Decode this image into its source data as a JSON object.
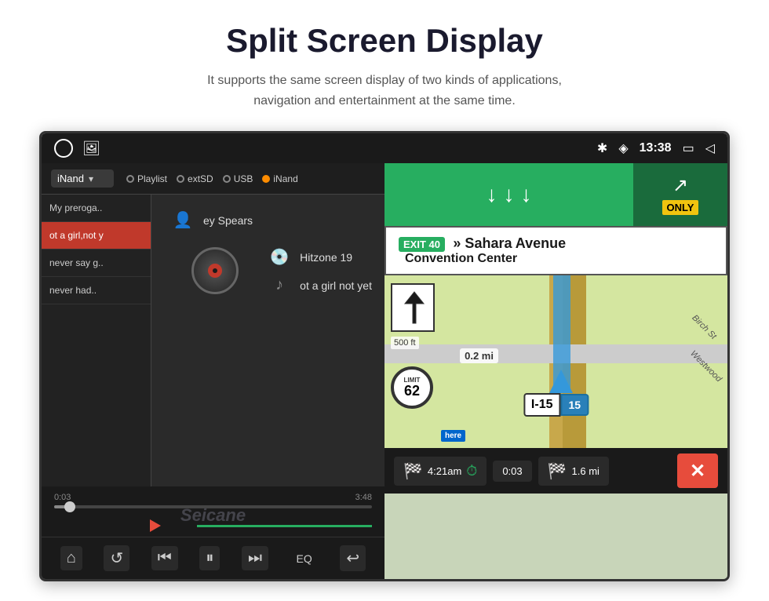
{
  "header": {
    "title": "Split Screen Display",
    "subtitle_line1": "It supports the same screen display of two kinds of applications,",
    "subtitle_line2": "navigation and entertainment at the same time."
  },
  "status_bar": {
    "time": "13:38",
    "icons": [
      "bluetooth",
      "location",
      "screen-record",
      "back"
    ]
  },
  "music_player": {
    "source_dropdown": "iNand",
    "dropdown_arrow": "▾",
    "source_tabs": [
      {
        "label": "Playlist",
        "active": false
      },
      {
        "label": "extSD",
        "active": false
      },
      {
        "label": "USB",
        "active": false
      },
      {
        "label": "iNand",
        "active": true
      }
    ],
    "playlist": [
      {
        "label": "My preroga..",
        "active": false
      },
      {
        "label": "ot a girl,not y",
        "active": true
      },
      {
        "label": "never say g..",
        "active": false
      },
      {
        "label": "never had..",
        "active": false
      }
    ],
    "track_artist": "ey Spears",
    "track_album": "Hitzone 19",
    "track_song": "ot a girl not yet",
    "progress_current": "0:03",
    "progress_total": "3:48",
    "watermark": "Seicane"
  },
  "navigation": {
    "exit_number": "EXIT 40",
    "exit_street": "» Sahara Avenue",
    "exit_subtitle": "Convention Center",
    "only_label": "ONLY",
    "distance_label": "0.2 mi",
    "speed_limit": "62",
    "speed_limit_label": "LIMIT",
    "highway_label": "I-15",
    "highway_shield": "15",
    "streets": [
      "Birch St",
      "Westwood"
    ],
    "eta_time": "4:21am",
    "trip_elapsed": "0:03",
    "trip_remaining": "1.6 mi"
  },
  "playback_controls": {
    "home": "⌂",
    "repeat": "↺",
    "prev": "⏮",
    "play_pause": "⏸",
    "next": "⏭",
    "eq": "EQ",
    "back": "↩"
  }
}
